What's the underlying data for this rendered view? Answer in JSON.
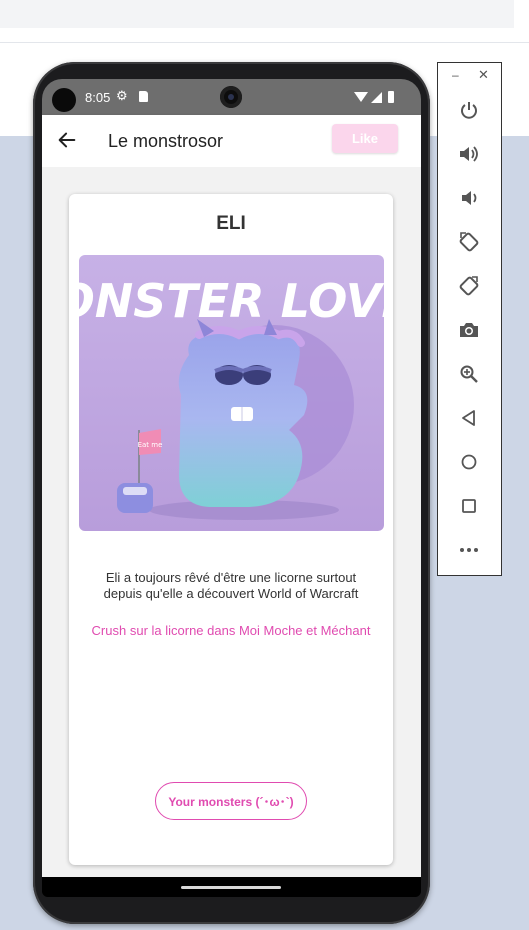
{
  "status_bar": {
    "time": "8:05"
  },
  "app_bar": {
    "title": "Le monstrosor",
    "like_label": "Like"
  },
  "card": {
    "name": "ELI",
    "description": "Eli a toujours rêvé d'être une licorne surtout depuis qu'elle a découvert World of Warcraft",
    "crush": "Crush sur la licorne dans Moi Moche et Méchant",
    "monsters_button": "Your monsters (´･ω･`)"
  },
  "image": {
    "headline": "MONSTER LOVER",
    "sign_text": "Eat me",
    "background_color": "#c9b5e6"
  },
  "side_toolbar": {
    "minimize": "–",
    "close": "✕",
    "buttons": [
      "power-icon",
      "volume-up-icon",
      "volume-down-icon",
      "rotate-left-icon",
      "rotate-right-icon",
      "camera-icon",
      "zoom-icon",
      "back-icon",
      "home-icon",
      "overview-icon",
      "more-icon"
    ]
  },
  "colors": {
    "accent": "#e04bb0",
    "like_bg": "#fbd6ec",
    "statusbar": "#6e6e6e"
  }
}
